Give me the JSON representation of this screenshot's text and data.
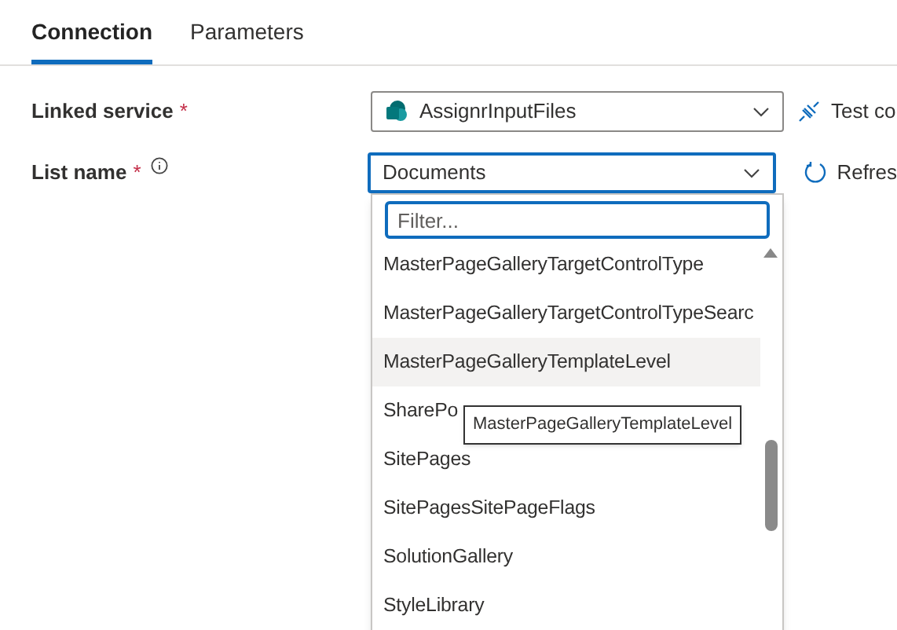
{
  "tabs": [
    {
      "label": "Connection",
      "selected": true
    },
    {
      "label": "Parameters",
      "selected": false
    }
  ],
  "form": {
    "linked_service": {
      "label": "Linked service",
      "required_mark": "*",
      "value": "AssignrInputFiles",
      "action": "Test co"
    },
    "list_name": {
      "label": "List name",
      "required_mark": "*",
      "value": "Documents",
      "action": "Refres",
      "focused": true
    }
  },
  "dropdown": {
    "filter": {
      "placeholder": "Filter..."
    },
    "items": [
      {
        "label": "MasterPageGalleryTargetControlType",
        "hovered": false
      },
      {
        "label": "MasterPageGalleryTargetControlTypeSearc",
        "hovered": false
      },
      {
        "label": "MasterPageGalleryTemplateLevel",
        "hovered": true
      },
      {
        "label": "SharePo",
        "hovered": false
      },
      {
        "label": "SitePages",
        "hovered": false
      },
      {
        "label": "SitePagesSitePageFlags",
        "hovered": false
      },
      {
        "label": "SolutionGallery",
        "hovered": false
      },
      {
        "label": "StyleLibrary",
        "hovered": false
      }
    ],
    "tooltip": "MasterPageGalleryTemplateLevel"
  }
}
